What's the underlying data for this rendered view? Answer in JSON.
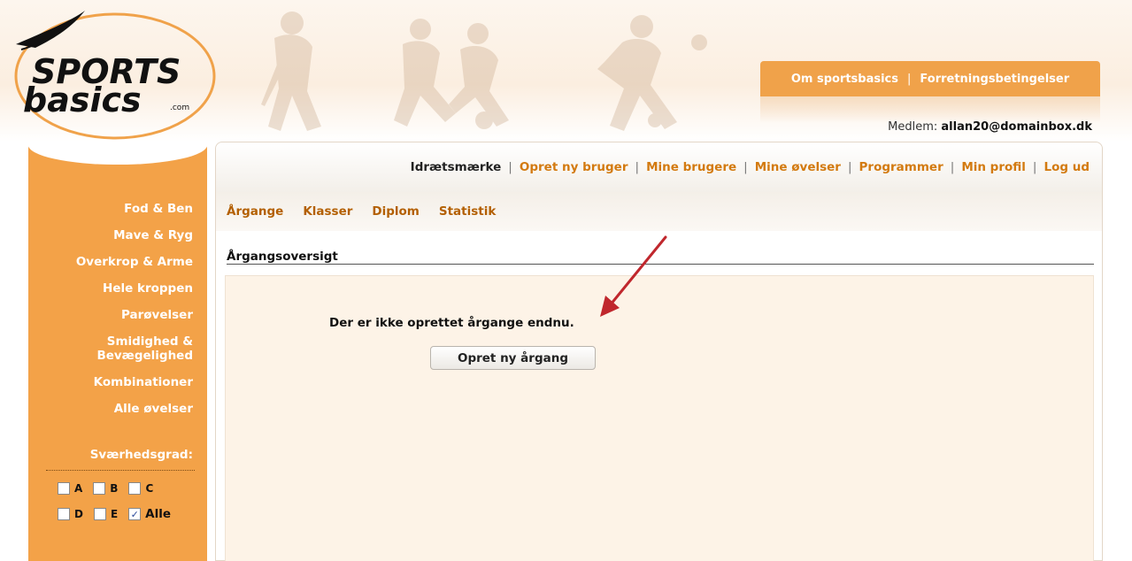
{
  "logo": {
    "line1": "SPORTS",
    "line2": "basics",
    "suffix": ".com"
  },
  "header": {
    "top_links": [
      "Om sportsbasics",
      "Forretningsbetingelser"
    ],
    "top_links_separator": "|",
    "member_label": "Medlem:",
    "member_email": "allan20@domainbox.dk"
  },
  "topnav": {
    "items": [
      "Idrætsmærke",
      "Opret ny bruger",
      "Mine brugere",
      "Mine øvelser",
      "Programmer",
      "Min profil",
      "Log ud"
    ],
    "separator": "|",
    "active_index": 0
  },
  "subnav": {
    "items": [
      "Årgange",
      "Klasser",
      "Diplom",
      "Statistik"
    ]
  },
  "main": {
    "section_title": "Årgangsoversigt",
    "empty_message": "Der er ikke oprettet årgange endnu.",
    "create_button": "Opret ny årgang"
  },
  "sidebar": {
    "items": [
      "Fod & Ben",
      "Mave & Ryg",
      "Overkrop & Arme",
      "Hele kroppen",
      "Parøvelser",
      "Smidighed & Bevægelighed",
      "Kombinationer",
      "Alle øvelser"
    ],
    "difficulty_label": "Sværhedsgrad:",
    "checkboxes": [
      {
        "label": "A",
        "checked": false
      },
      {
        "label": "B",
        "checked": false
      },
      {
        "label": "C",
        "checked": false
      },
      {
        "label": "D",
        "checked": false
      },
      {
        "label": "E",
        "checked": false
      },
      {
        "label": "Alle",
        "checked": true
      }
    ]
  },
  "colors": {
    "accent": "#f3a248",
    "link": "#d37a10",
    "content_bg": "#fdf3e7",
    "arrow": "#c0272d"
  },
  "icons": {
    "checkbox_checked": "checkmark-icon",
    "annotation": "arrow-icon"
  }
}
